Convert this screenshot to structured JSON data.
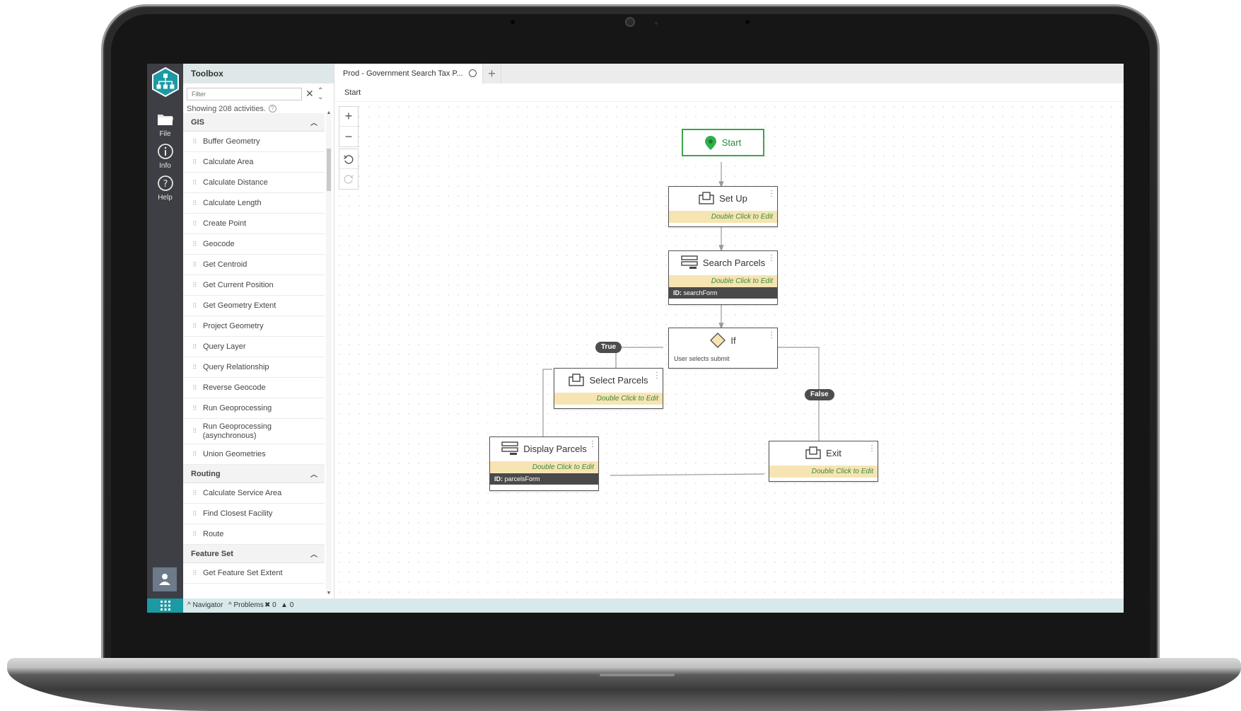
{
  "rail": {
    "items": [
      {
        "label": "File",
        "icon": "folder-icon"
      },
      {
        "label": "Info",
        "icon": "info-icon"
      },
      {
        "label": "Help",
        "icon": "help-icon"
      }
    ]
  },
  "toolbox": {
    "title": "Toolbox",
    "filter_placeholder": "Filter",
    "showing": "Showing 208 activities.",
    "categories": [
      {
        "name": "GIS",
        "items": [
          "Buffer Geometry",
          "Calculate Area",
          "Calculate Distance",
          "Calculate Length",
          "Create Point",
          "Geocode",
          "Get Centroid",
          "Get Current Position",
          "Get Geometry Extent",
          "Project Geometry",
          "Query Layer",
          "Query Relationship",
          "Reverse Geocode",
          "Run Geoprocessing",
          "Run Geoprocessing (asynchronous)",
          "Union Geometries"
        ]
      },
      {
        "name": "Routing",
        "items": [
          "Calculate Service Area",
          "Find Closest Facility",
          "Route"
        ]
      },
      {
        "name": "Feature Set",
        "items": [
          "Get Feature Set Extent"
        ]
      }
    ]
  },
  "tabs": [
    {
      "label": "Prod - Government Search Tax P..."
    }
  ],
  "breadcrumb": "Start",
  "workflow": {
    "start_label": "Start",
    "edit_hint": "Double Click to Edit",
    "nodes": {
      "setup": {
        "title": "Set Up"
      },
      "search": {
        "title": "Search Parcels",
        "id_label": "ID:",
        "id_value": "searchForm"
      },
      "if": {
        "title": "If",
        "subtitle": "User selects submit"
      },
      "select": {
        "title": "Select Parcels"
      },
      "display": {
        "title": "Display Parcels",
        "id_label": "ID:",
        "id_value": "parcelsForm"
      },
      "exit": {
        "title": "Exit"
      }
    },
    "edges": {
      "true_label": "True",
      "false_label": "False"
    }
  },
  "statusbar": {
    "navigator": "Navigator",
    "problems": "Problems",
    "errors": "0",
    "warnings": "0"
  },
  "colors": {
    "accent": "#1c9aa4",
    "rail": "#3d3f44",
    "start_green": "#3aa64a",
    "edit_bar": "#f6e4b3",
    "id_bar": "#4a4a4a"
  }
}
